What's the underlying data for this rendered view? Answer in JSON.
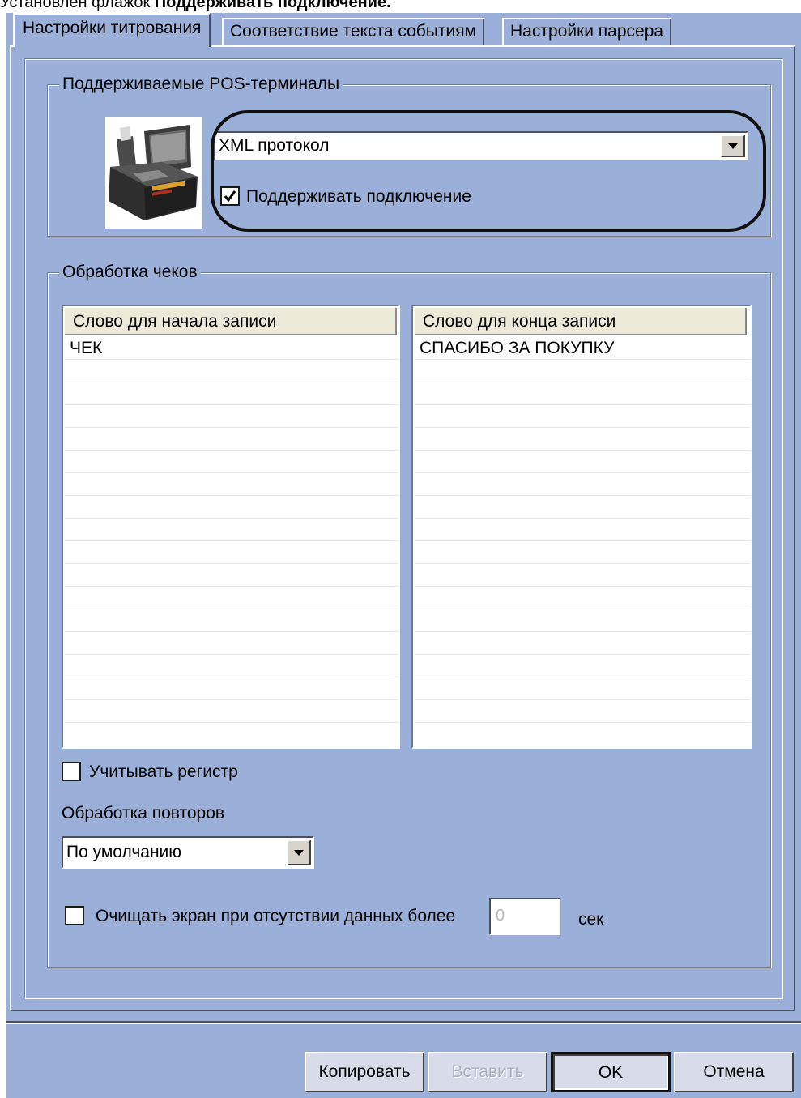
{
  "caption": {
    "prefix": "Установлен флажок",
    "bold": "Поддерживать подключение."
  },
  "tabs": [
    {
      "label": "Настройки титрования",
      "active": true
    },
    {
      "label": "Соответствие текста событиям",
      "active": false
    },
    {
      "label": "Настройки парсера",
      "active": false
    }
  ],
  "pos_group": {
    "title": "Поддерживаемые POS-терминалы",
    "image_icon": "pos-terminal-icon",
    "protocol": {
      "selected": "XML протокол"
    },
    "support_connection": {
      "label": "Поддерживать подключение",
      "checked": true
    }
  },
  "receipt_group": {
    "title": "Обработка чеков",
    "start_list": {
      "header": "Слово для начала записи",
      "items": [
        "ЧЕК"
      ]
    },
    "end_list": {
      "header": "Слово для конца записи",
      "items": [
        "СПАСИБО ЗА ПОКУПКУ"
      ]
    },
    "case_sensitive": {
      "label": "Учитывать регистр",
      "checked": false
    },
    "repeat_label": "Обработка повторов",
    "repeat_combo": {
      "selected": "По умолчанию"
    },
    "clear_screen": {
      "label": "Очищать экран при отсутствии данных более",
      "checked": false,
      "value": "0",
      "unit": "сек"
    }
  },
  "buttons": {
    "copy": "Копировать",
    "paste": "Вставить",
    "ok": "OK",
    "cancel": "Отмена"
  },
  "colors": {
    "dialog_bg": "#9bb0d8",
    "field_bg": "#ffffff",
    "highlight": "#101010"
  }
}
